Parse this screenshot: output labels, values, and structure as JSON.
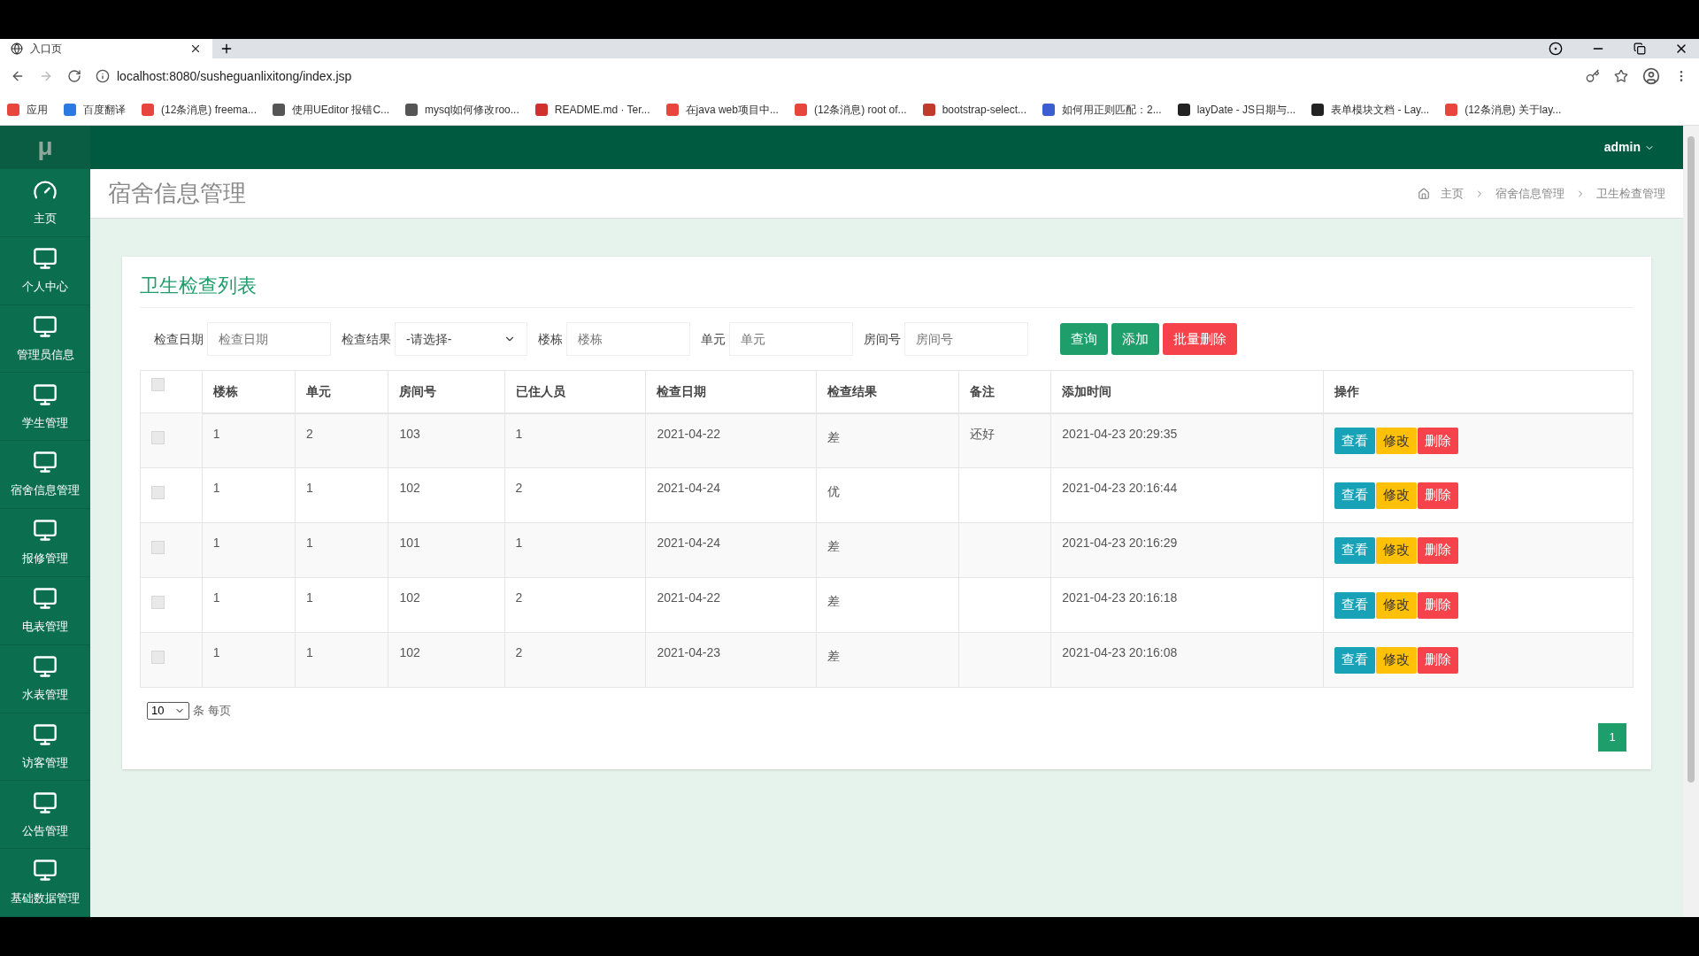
{
  "browser": {
    "tab": {
      "title": "入口页"
    },
    "url": "localhost:8080/susheguanlixitong/index.jsp",
    "bookmarks": [
      {
        "label": "应用",
        "color": "#e8453c"
      },
      {
        "label": "百度翻译",
        "color": "#2a7ae2"
      },
      {
        "label": "(12条消息) freema...",
        "color": "#e8453c"
      },
      {
        "label": "使用UEditor 报错C...",
        "color": "#555555"
      },
      {
        "label": "mysql如何修改roo...",
        "color": "#555555"
      },
      {
        "label": "README.md · Ter...",
        "color": "#d0312d"
      },
      {
        "label": "在java web项目中...",
        "color": "#e8453c"
      },
      {
        "label": "(12条消息) root of...",
        "color": "#e8453c"
      },
      {
        "label": "bootstrap-select...",
        "color": "#c0392b"
      },
      {
        "label": "如何用正则匹配：2...",
        "color": "#3a5ecf"
      },
      {
        "label": "layDate - JS日期与...",
        "color": "#222222"
      },
      {
        "label": "表单模块文档 - Lay...",
        "color": "#222222"
      },
      {
        "label": "(12条消息) 关于lay...",
        "color": "#e8453c"
      }
    ]
  },
  "sidebar": {
    "logo": "μ",
    "items": [
      {
        "label": "主页",
        "kind": "dashboard"
      },
      {
        "label": "个人中心",
        "kind": "monitor"
      },
      {
        "label": "管理员信息",
        "kind": "monitor"
      },
      {
        "label": "学生管理",
        "kind": "monitor"
      },
      {
        "label": "宿舍信息管理",
        "kind": "monitor"
      },
      {
        "label": "报修管理",
        "kind": "monitor"
      },
      {
        "label": "电表管理",
        "kind": "monitor"
      },
      {
        "label": "水表管理",
        "kind": "monitor"
      },
      {
        "label": "访客管理",
        "kind": "monitor"
      },
      {
        "label": "公告管理",
        "kind": "monitor"
      },
      {
        "label": "基础数据管理",
        "kind": "monitor"
      }
    ]
  },
  "header": {
    "user": "admin"
  },
  "page": {
    "title": "宿舍信息管理",
    "breadcrumbs": [
      "主页",
      "宿舍信息管理",
      "卫生检查管理"
    ]
  },
  "card": {
    "title": "卫生检查列表",
    "filters": [
      {
        "label": "检查日期",
        "kind": "input",
        "placeholder": "检查日期"
      },
      {
        "label": "检查结果",
        "kind": "select",
        "value": "-请选择-"
      },
      {
        "label": "楼栋",
        "kind": "input",
        "placeholder": "楼栋"
      },
      {
        "label": "单元",
        "kind": "input",
        "placeholder": "单元"
      },
      {
        "label": "房间号",
        "kind": "input",
        "placeholder": "房间号"
      }
    ],
    "buttons": [
      {
        "label": "查询",
        "kind": "success"
      },
      {
        "label": "添加",
        "kind": "success"
      },
      {
        "label": "批量删除",
        "kind": "danger"
      }
    ],
    "table": {
      "header_checked": false,
      "columns": [
        "楼栋",
        "单元",
        "房间号",
        "已住人员",
        "检查日期",
        "检查结果",
        "备注",
        "添加时间",
        "操作"
      ],
      "rows": [
        {
          "checked": false,
          "cells": [
            "1",
            "2",
            "103",
            "1",
            "2021-04-22",
            "差",
            "还好",
            "2021-04-23 20:29:35"
          ],
          "actions": [
            {
              "label": "查看",
              "kind": "info"
            },
            {
              "label": "修改",
              "kind": "warning"
            },
            {
              "label": "删除",
              "kind": "danger"
            }
          ]
        },
        {
          "checked": false,
          "cells": [
            "1",
            "1",
            "102",
            "2",
            "2021-04-24",
            "优",
            "",
            "2021-04-23 20:16:44"
          ],
          "actions": [
            {
              "label": "查看",
              "kind": "info"
            },
            {
              "label": "修改",
              "kind": "warning"
            },
            {
              "label": "删除",
              "kind": "danger"
            }
          ]
        },
        {
          "checked": false,
          "cells": [
            "1",
            "1",
            "101",
            "1",
            "2021-04-24",
            "差",
            "",
            "2021-04-23 20:16:29"
          ],
          "actions": [
            {
              "label": "查看",
              "kind": "info"
            },
            {
              "label": "修改",
              "kind": "warning"
            },
            {
              "label": "删除",
              "kind": "danger"
            }
          ]
        },
        {
          "checked": false,
          "cells": [
            "1",
            "1",
            "102",
            "2",
            "2021-04-22",
            "差",
            "",
            "2021-04-23 20:16:18"
          ],
          "actions": [
            {
              "label": "查看",
              "kind": "info"
            },
            {
              "label": "修改",
              "kind": "warning"
            },
            {
              "label": "删除",
              "kind": "danger"
            }
          ]
        },
        {
          "checked": false,
          "cells": [
            "1",
            "1",
            "102",
            "2",
            "2021-04-23",
            "差",
            "",
            "2021-04-23 20:16:08"
          ],
          "actions": [
            {
              "label": "查看",
              "kind": "info"
            },
            {
              "label": "修改",
              "kind": "warning"
            },
            {
              "label": "删除",
              "kind": "danger"
            }
          ]
        }
      ]
    },
    "page_size": "10",
    "page_size_label": "条 每页",
    "pages": [
      {
        "label": "1",
        "selected": true
      }
    ]
  }
}
